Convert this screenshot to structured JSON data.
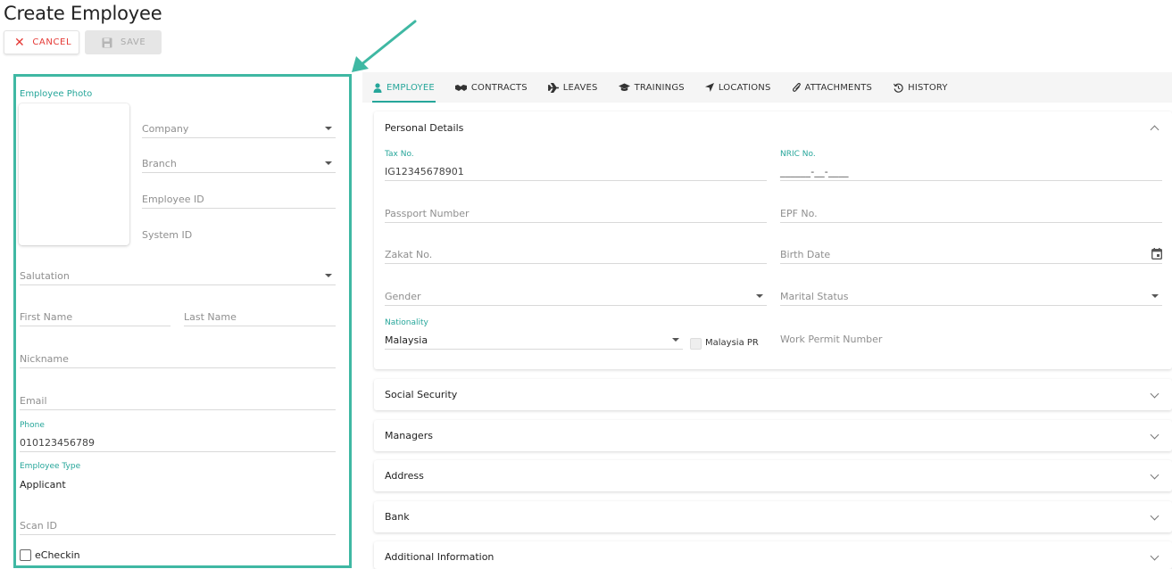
{
  "page": {
    "title": "Create Employee"
  },
  "toolbar": {
    "cancel_label": "CANCEL",
    "save_label": "SAVE"
  },
  "colors": {
    "accent": "#26a69a",
    "highlight_border": "#3fb8a3",
    "cancel": "#e53935"
  },
  "left": {
    "photo_label": "Employee Photo",
    "company": "Company",
    "branch": "Branch",
    "employee_id": "Employee ID",
    "system_id": "System ID",
    "salutation": "Salutation",
    "first_name": "First Name",
    "last_name": "Last Name",
    "nickname": "Nickname",
    "email": "Email",
    "phone_label": "Phone",
    "phone_value": "010123456789",
    "employee_type_label": "Employee Type",
    "employee_type_value": "Applicant",
    "scan_id": "Scan ID",
    "echeckin": "eCheckin"
  },
  "tabs": [
    {
      "label": "EMPLOYEE",
      "icon": "person-icon",
      "active": true
    },
    {
      "label": "CONTRACTS",
      "icon": "handshake-icon",
      "active": false
    },
    {
      "label": "LEAVES",
      "icon": "plane-icon",
      "active": false
    },
    {
      "label": "TRAININGS",
      "icon": "graduation-cap-icon",
      "active": false
    },
    {
      "label": "LOCATIONS",
      "icon": "location-arrow-icon",
      "active": false
    },
    {
      "label": "ATTACHMENTS",
      "icon": "paperclip-icon",
      "active": false
    },
    {
      "label": "HISTORY",
      "icon": "history-icon",
      "active": false
    }
  ],
  "personal": {
    "title": "Personal Details",
    "tax_label": "Tax No.",
    "tax_value": "IG12345678901",
    "nric_label": "NRIC No.",
    "nric_value": "______-__-____",
    "passport": "Passport Number",
    "epf": "EPF No.",
    "zakat": "Zakat No.",
    "birth_date": "Birth Date",
    "gender": "Gender",
    "marital": "Marital Status",
    "nationality_label": "Nationality",
    "nationality_value": "Malaysia",
    "malaysia_pr": "Malaysia PR",
    "work_permit": "Work Permit Number"
  },
  "sections": [
    "Social Security",
    "Managers",
    "Address",
    "Bank",
    "Additional Information"
  ]
}
